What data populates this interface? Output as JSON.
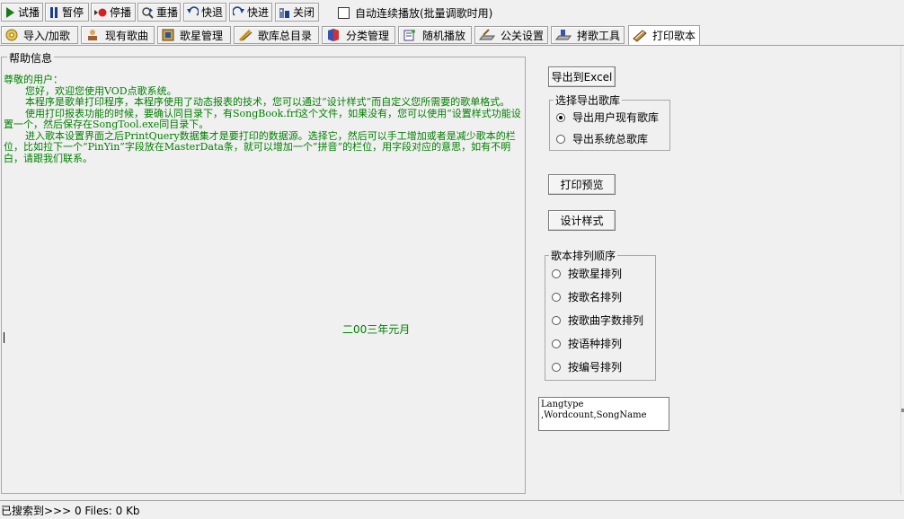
{
  "toolbar": {
    "buttons": [
      {
        "label": "试播",
        "icon": "play-icon"
      },
      {
        "label": "暂停",
        "icon": "pause-icon"
      },
      {
        "label": "停播",
        "icon": "stop-icon"
      },
      {
        "label": "重播",
        "icon": "replay-icon"
      },
      {
        "label": "快退",
        "icon": "rewind-icon"
      },
      {
        "label": "快进",
        "icon": "fast-forward-icon"
      },
      {
        "label": "关闭",
        "icon": "close-icon"
      }
    ],
    "autoplay_label": "自动连续播放(批量调歌时用)"
  },
  "tabs": [
    {
      "label": "导入/加歌",
      "icon": "cd-icon"
    },
    {
      "label": "现有歌曲",
      "icon": "songs-icon"
    },
    {
      "label": "歌星管理",
      "icon": "singer-icon"
    },
    {
      "label": "歌库总目录",
      "icon": "catalog-icon"
    },
    {
      "label": "分类管理",
      "icon": "category-icon"
    },
    {
      "label": "随机播放",
      "icon": "random-icon"
    },
    {
      "label": "公关设置",
      "icon": "settings-icon"
    },
    {
      "label": "拷歌工具",
      "icon": "copy-tool-icon"
    },
    {
      "label": "打印歌本",
      "icon": "print-book-icon"
    }
  ],
  "help": {
    "legend": "帮助信息",
    "greeting": "尊敬的用户：",
    "paragraphs": [
      "您好，欢迎您使用VOD点歌系统。",
      "本程序是歌单打印程序，本程序使用了动态报表的技术，您可以通过“设计样式”而自定义您所需要的歌单格式。",
      "使用打印报表功能的时候，要确认同目录下，有SongBook.frf这个文件，如果没有，您可以使用“设置样式功能设置一个，然后保存在SongTool.exe同目录下。",
      "进入歌本设置界面之后PrintQuery数据集才是要打印的数据源。选择它，然后可以手工增加或者是减少歌本的栏位，比如拉下一个“PinYin”字段放在MasterData条，就可以增加一个”拼音“的栏位，用字段对应的意思，如有不明白，请跟我们联系。"
    ],
    "date": "二00三年元月"
  },
  "right": {
    "export_excel": "导出到Excel",
    "export_group": {
      "label": "选择导出歌库",
      "options": [
        "导出用户现有歌库",
        "导出系统总歌库"
      ],
      "selected": 0
    },
    "print_preview": "打印预览",
    "design_style": "设计样式",
    "sort_group": {
      "label": "歌本排列顺序",
      "options": [
        "按歌星排列",
        "按歌名排列",
        "按歌曲字数排列",
        "按语种排列",
        "按编号排列"
      ]
    },
    "fields_memo": "Langtype\n,Wordcount,SongName"
  },
  "status": {
    "text": "已搜索到>>> 0 Files: 0 Kb"
  }
}
